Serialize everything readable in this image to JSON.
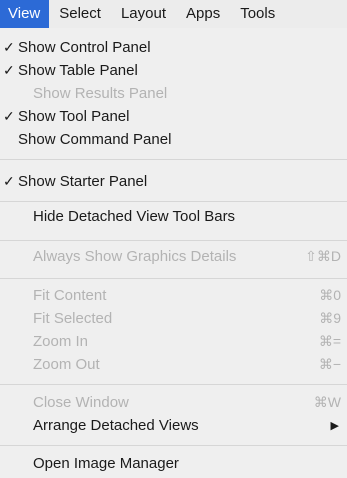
{
  "menubar": {
    "items": [
      "View",
      "Select",
      "Layout",
      "Apps",
      "Tools"
    ]
  },
  "menu": {
    "items": [
      {
        "label": "Show Control Panel",
        "checked": true,
        "enabled": true
      },
      {
        "label": "Show Table Panel",
        "checked": true,
        "enabled": true
      },
      {
        "label": "Show Results Panel",
        "checked": false,
        "enabled": false
      },
      {
        "label": "Show Tool Panel",
        "checked": true,
        "enabled": true
      },
      {
        "label": "Show Command Panel",
        "checked": false,
        "enabled": true
      },
      {
        "label": "Show Starter Panel",
        "checked": true,
        "enabled": true
      },
      {
        "label": "Hide Detached View Tool Bars",
        "enabled": true
      },
      {
        "label": "Always Show Graphics Details",
        "enabled": false,
        "shortcut": "⇧⌘D"
      },
      {
        "label": "Fit Content",
        "enabled": false,
        "shortcut": "⌘0"
      },
      {
        "label": "Fit Selected",
        "enabled": false,
        "shortcut": "⌘9"
      },
      {
        "label": "Zoom In",
        "enabled": false,
        "shortcut": "⌘="
      },
      {
        "label": "Zoom Out",
        "enabled": false,
        "shortcut": "⌘−"
      },
      {
        "label": "Close Window",
        "enabled": false,
        "shortcut": "⌘W"
      },
      {
        "label": "Arrange Detached Views",
        "enabled": true,
        "submenu": true
      },
      {
        "label": "Open Image Manager",
        "enabled": true
      }
    ],
    "check_glyph": "✓",
    "submenu_glyph": "▶"
  }
}
